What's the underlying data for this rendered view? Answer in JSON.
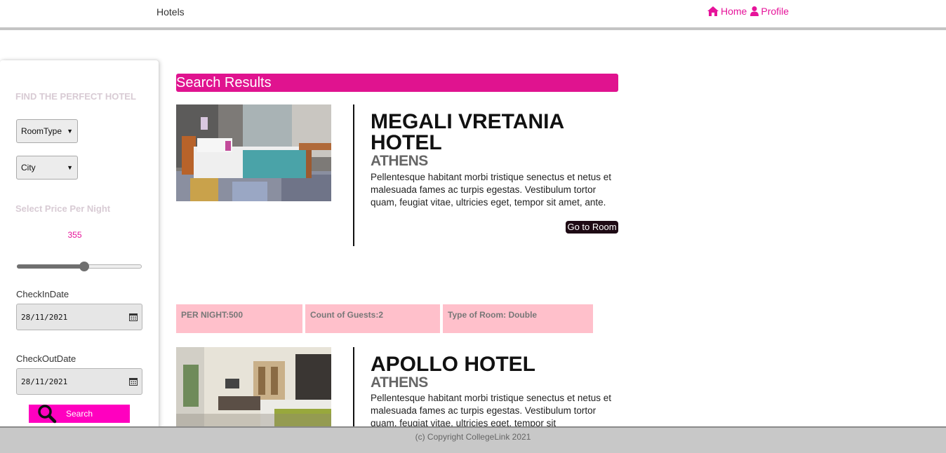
{
  "nav": {
    "brand": "Hotels",
    "home_label": "Home",
    "profile_label": "Profile",
    "accent": "#e6149a"
  },
  "sidebar": {
    "title": "FIND THE PERFECT HOTEL",
    "room_type_select": "RoomType",
    "city_select": "City",
    "price_title": "Select Price Per Night",
    "price_value": "355",
    "price_slider_fraction": 0.54,
    "checkin_label": "CheckInDate",
    "checkin_value": "28/11/2021",
    "checkout_label": "CheckOutDate",
    "checkout_value": "28/11/2021",
    "search_label": "Search",
    "search_color": "#ff00bf"
  },
  "results": {
    "header": "Search Results",
    "header_color": "#e0138f",
    "hotels": [
      {
        "name": "MEGALI VRETANIA HOTEL",
        "city": "ATHENS",
        "description": "Pellentesque habitant morbi tristique senectus et netus et malesuada fames ac turpis egestas. Vestibulum tortor quam, feugiat vitae, ultricies eget, tempor sit amet, ante.",
        "button": "Go to Room",
        "per_night": "PER NIGHT:500",
        "guests": "Count of Guests:2",
        "room_type": "Type of Room: Double"
      },
      {
        "name": "APOLLO HOTEL",
        "city": "ATHENS",
        "description": "Pellentesque habitant morbi tristique senectus et netus et malesuada fames ac turpis egestas. Vestibulum tortor quam, feugiat vitae, ultricies eget, tempor sit"
      }
    ]
  },
  "footer": {
    "text": "(c) Copyright CollegeLink 2021"
  }
}
